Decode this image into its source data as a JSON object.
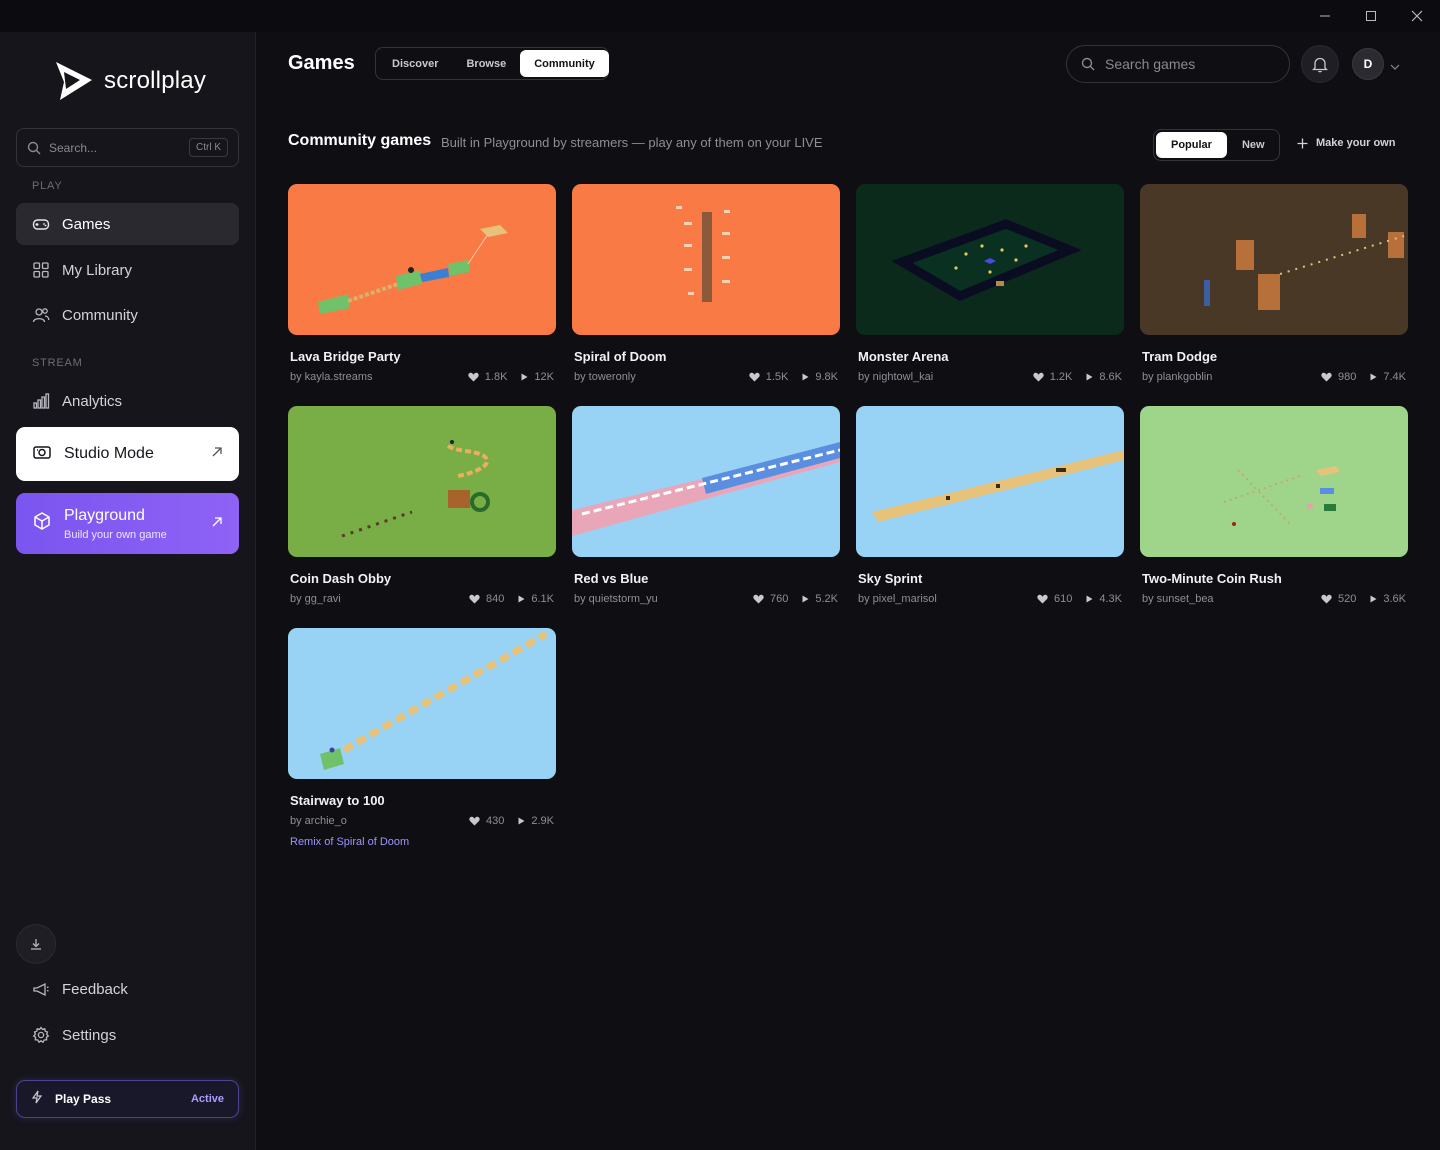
{
  "window": {
    "minimize_icon": "minimize-icon",
    "maximize_icon": "maximize-icon",
    "close_icon": "close-icon"
  },
  "brand": {
    "name": "scrollplay"
  },
  "sidebar": {
    "search": {
      "placeholder": "Search...",
      "shortcut": "Ctrl K"
    },
    "play_label": "PLAY",
    "stream_label": "STREAM",
    "items": [
      {
        "label": "Games",
        "icon": "gamepad-icon"
      },
      {
        "label": "My Library",
        "icon": "grid-icon"
      },
      {
        "label": "Community",
        "icon": "users-icon"
      },
      {
        "label": "Analytics",
        "icon": "bar-chart-icon"
      }
    ],
    "studio_mode": {
      "label": "Studio Mode",
      "icon": "camera-icon"
    },
    "playground": {
      "title": "Playground",
      "subtitle": "Build your own game",
      "icon": "cube-icon"
    },
    "feedback": {
      "label": "Feedback",
      "icon": "megaphone-icon"
    },
    "settings": {
      "label": "Settings",
      "icon": "gear-icon"
    },
    "play_pass": {
      "label": "Play Pass",
      "status": "Active",
      "icon": "bolt-icon"
    }
  },
  "header": {
    "title": "Games",
    "tabs": [
      {
        "label": "Discover"
      },
      {
        "label": "Browse"
      },
      {
        "label": "Community"
      }
    ],
    "active_tab": "Community",
    "search_placeholder": "Search games",
    "avatar_initial": "D"
  },
  "section": {
    "title": "Community games",
    "subtitle": "Built in Playground by streamers — play any of them on your LIVE",
    "sort": [
      {
        "label": "Popular"
      },
      {
        "label": "New"
      }
    ],
    "active_sort": "Popular",
    "make_own": "Make your own"
  },
  "colors": {
    "accent": "#7b55f0",
    "active_tab_bg": "#ffffff",
    "remix_link": "#9b95ff"
  },
  "games": [
    {
      "title": "Lava Bridge Party",
      "author": "by kayla.streams",
      "likes": "1.8K",
      "plays": "12K",
      "thumb_bg": "#f97a44"
    },
    {
      "title": "Spiral of Doom",
      "author": "by toweronly",
      "likes": "1.5K",
      "plays": "9.8K",
      "thumb_bg": "#f97a44"
    },
    {
      "title": "Monster Arena",
      "author": "by nightowl_kai",
      "likes": "1.2K",
      "plays": "8.6K",
      "thumb_bg": "#0c2a1c"
    },
    {
      "title": "Tram Dodge",
      "author": "by plankgoblin",
      "likes": "980",
      "plays": "7.4K",
      "thumb_bg": "#4a3827"
    },
    {
      "title": "Coin Dash Obby",
      "author": "by gg_ravi",
      "likes": "840",
      "plays": "6.1K",
      "thumb_bg": "#79ad45"
    },
    {
      "title": "Red vs Blue",
      "author": "by quietstorm_yu",
      "likes": "760",
      "plays": "5.2K",
      "thumb_bg": "#98d3f5"
    },
    {
      "title": "Sky Sprint",
      "author": "by pixel_marisol",
      "likes": "610",
      "plays": "4.3K",
      "thumb_bg": "#98d3f5"
    },
    {
      "title": "Two-Minute Coin Rush",
      "author": "by sunset_bea",
      "likes": "520",
      "plays": "3.6K",
      "thumb_bg": "#9fd58a"
    },
    {
      "title": "Stairway to 100",
      "author": "by archie_o",
      "likes": "430",
      "plays": "2.9K",
      "thumb_bg": "#98d3f5",
      "remix": "Remix of Spiral of Doom"
    }
  ]
}
